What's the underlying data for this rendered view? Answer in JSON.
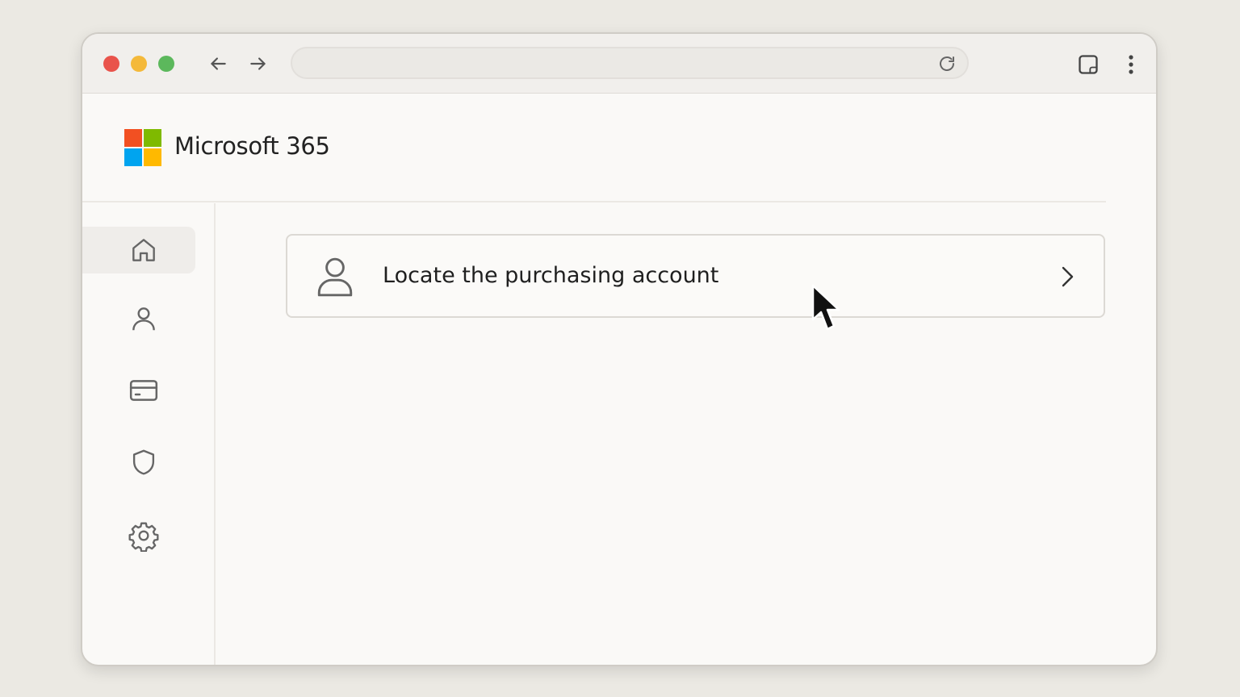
{
  "browser": {
    "window_controls": [
      "close",
      "minimize",
      "maximize"
    ],
    "nav": {
      "back_icon": "arrow-left-icon",
      "forward_icon": "arrow-right-icon"
    },
    "address_bar": {
      "value": "",
      "placeholder": ""
    },
    "icons": [
      "reload-icon",
      "tab-icon",
      "more-vertical-icon"
    ]
  },
  "header": {
    "brand": "Microsoft 365",
    "logo_colors": {
      "top_left": "#f25022",
      "top_right": "#7fba00",
      "bottom_left": "#00a4ef",
      "bottom_right": "#ffb900"
    }
  },
  "sidebar": {
    "items": [
      {
        "icon": "home-icon",
        "active": true
      },
      {
        "icon": "user-icon",
        "active": false
      },
      {
        "icon": "billing-card-icon",
        "active": false
      },
      {
        "icon": "shield-icon",
        "active": false
      },
      {
        "icon": "gear-icon",
        "active": false
      }
    ]
  },
  "main": {
    "card": {
      "label": "Locate the purchasing account",
      "icon": "user-icon",
      "action_icon": "chevron-right-icon"
    }
  },
  "colors": {
    "page_bg": "#ebe9e3",
    "window_bg": "#faf9f7",
    "active_item_bg": "#efedea"
  }
}
